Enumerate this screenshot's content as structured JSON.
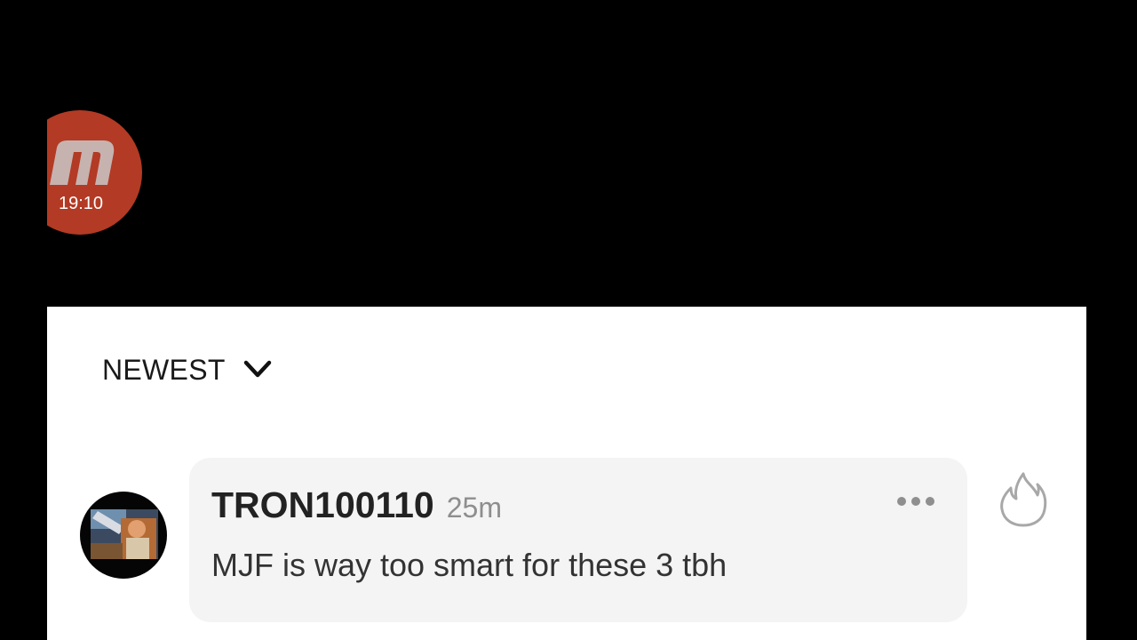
{
  "app_bubble": {
    "icon": "m-logo-icon",
    "time": "19:10",
    "color": "#b33a24"
  },
  "sort": {
    "label": "NEWEST",
    "icon": "chevron-down-icon"
  },
  "comments": [
    {
      "author": "TRON100110",
      "time": "25m",
      "text": "MJF is way too smart for these 3 tbh",
      "more_icon": "more-dots-icon",
      "reaction_icon": "fire-icon"
    }
  ]
}
